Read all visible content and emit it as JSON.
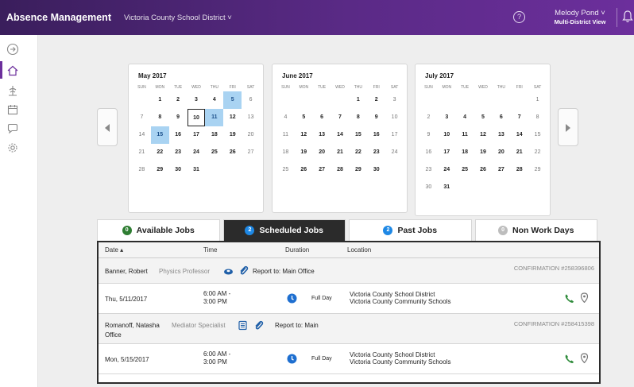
{
  "header": {
    "app_title": "Absence Management",
    "district": "Victoria County School District ˅",
    "help_label": "?",
    "user_name": "Melody Pond ˅",
    "user_view": "Multi-District View"
  },
  "sidebar": {
    "icons": [
      "arrow-right-circle-icon",
      "home-icon",
      "tree-icon",
      "calendar-icon",
      "chat-icon",
      "gear-icon"
    ]
  },
  "calendars": [
    {
      "title": "May 2017",
      "dow": [
        "SUN",
        "MON",
        "TUE",
        "WED",
        "THU",
        "FRI",
        "SAT"
      ],
      "days": [
        "",
        "1",
        "2",
        "3",
        "4",
        "5",
        "6",
        "7",
        "8",
        "9",
        "10",
        "11",
        "12",
        "13",
        "14",
        "15",
        "16",
        "17",
        "18",
        "19",
        "20",
        "21",
        "22",
        "23",
        "24",
        "25",
        "26",
        "27",
        "28",
        "29",
        "30",
        "31",
        "",
        "",
        ""
      ],
      "selected": [
        "5",
        "11",
        "15"
      ],
      "today": "10"
    },
    {
      "title": "June 2017",
      "dow": [
        "SUN",
        "MON",
        "TUE",
        "WED",
        "THU",
        "FRI",
        "SAT"
      ],
      "days": [
        "",
        "",
        "",
        "",
        "1",
        "2",
        "3",
        "4",
        "5",
        "6",
        "7",
        "8",
        "9",
        "10",
        "11",
        "12",
        "13",
        "14",
        "15",
        "16",
        "17",
        "18",
        "19",
        "20",
        "21",
        "22",
        "23",
        "24",
        "25",
        "26",
        "27",
        "28",
        "29",
        "30",
        ""
      ],
      "selected": [],
      "today": ""
    },
    {
      "title": "July 2017",
      "dow": [
        "SUN",
        "MON",
        "TUE",
        "WED",
        "THU",
        "FRI",
        "SAT"
      ],
      "days": [
        "",
        "",
        "",
        "",
        "",
        "",
        "1",
        "2",
        "3",
        "4",
        "5",
        "6",
        "7",
        "8",
        "9",
        "10",
        "11",
        "12",
        "13",
        "14",
        "15",
        "16",
        "17",
        "18",
        "19",
        "20",
        "21",
        "22",
        "23",
        "24",
        "25",
        "26",
        "27",
        "28",
        "29",
        "30",
        "31",
        "",
        "",
        "",
        "",
        ""
      ],
      "selected": [],
      "today": ""
    }
  ],
  "tabs": [
    {
      "label": "Available Jobs",
      "count": "0",
      "badge_color": "#2e7d32"
    },
    {
      "label": "Scheduled Jobs",
      "count": "2",
      "badge_color": "#1e88e5"
    },
    {
      "label": "Past Jobs",
      "count": "2",
      "badge_color": "#1e88e5"
    },
    {
      "label": "Non Work Days",
      "count": "0",
      "badge_color": "#bdbdbd"
    }
  ],
  "table": {
    "headers": {
      "date": "Date ▴",
      "time": "Time",
      "duration": "Duration",
      "location": "Location"
    },
    "jobs": [
      {
        "employee": "Banner, Robert",
        "role": "Physics Professor",
        "report": "Report to: Main Office",
        "report_cont": "",
        "confirmation": "CONFIRMATION #258396806",
        "date": "Thu, 5/11/2017",
        "time_start": "6:00 AM -",
        "time_end": "3:00 PM",
        "duration": "Full Day",
        "location_1": "Victoria County School District",
        "location_2": "Victoria County Community Schools"
      },
      {
        "employee": "Romanoff, Natasha",
        "role": "Mediator Specialist",
        "report": "Report to: Main",
        "report_cont": "Office",
        "confirmation": "CONFIRMATION #258415398",
        "date": "Mon, 5/15/2017",
        "time_start": "6:00 AM -",
        "time_end": "3:00 PM",
        "duration": "Full Day",
        "location_1": "Victoria County School District",
        "location_2": "Victoria County Community Schools"
      }
    ]
  },
  "colors": {
    "brand": "#5a2a86",
    "selected_day": "#a9d3f2",
    "phone": "#2e8b3a"
  }
}
